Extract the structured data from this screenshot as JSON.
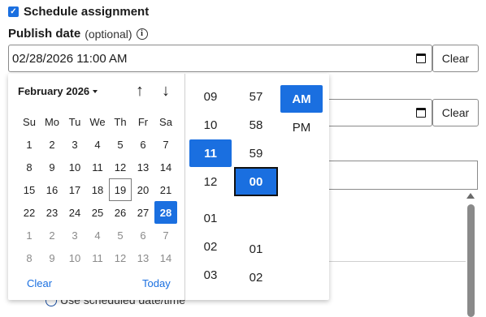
{
  "schedule": {
    "label": "Schedule assignment",
    "checked": true
  },
  "publish": {
    "label": "Publish date",
    "optional": "(optional)",
    "value": "02/28/2026 11:00 AM",
    "clear": "Clear"
  },
  "second_field": {
    "clear": "Clear"
  },
  "background": {
    "radio_text": "Use scheduled date/time"
  },
  "calendar": {
    "month": "February 2026",
    "weekdays": [
      "Su",
      "Mo",
      "Tu",
      "We",
      "Th",
      "Fr",
      "Sa"
    ],
    "weeks": [
      [
        "1",
        "2",
        "3",
        "4",
        "5",
        "6",
        "7"
      ],
      [
        "8",
        "9",
        "10",
        "11",
        "12",
        "13",
        "14"
      ],
      [
        "15",
        "16",
        "17",
        "18",
        "19",
        "20",
        "21"
      ],
      [
        "22",
        "23",
        "24",
        "25",
        "26",
        "27",
        "28"
      ],
      [
        "1",
        "2",
        "3",
        "4",
        "5",
        "6",
        "7"
      ],
      [
        "8",
        "9",
        "10",
        "11",
        "12",
        "13",
        "14"
      ]
    ],
    "today": "19",
    "selected": "28",
    "clear": "Clear",
    "today_label": "Today"
  },
  "time": {
    "hours": [
      "09",
      "10",
      "11",
      "12",
      "",
      "01",
      "02",
      "03"
    ],
    "selected_hour": "11",
    "minutes": [
      "57",
      "58",
      "59",
      "00",
      "",
      "01",
      "02"
    ],
    "selected_minute": "00",
    "periods": [
      "AM",
      "PM"
    ],
    "selected_period": "AM"
  },
  "colors": {
    "accent": "#1a6fe0"
  }
}
